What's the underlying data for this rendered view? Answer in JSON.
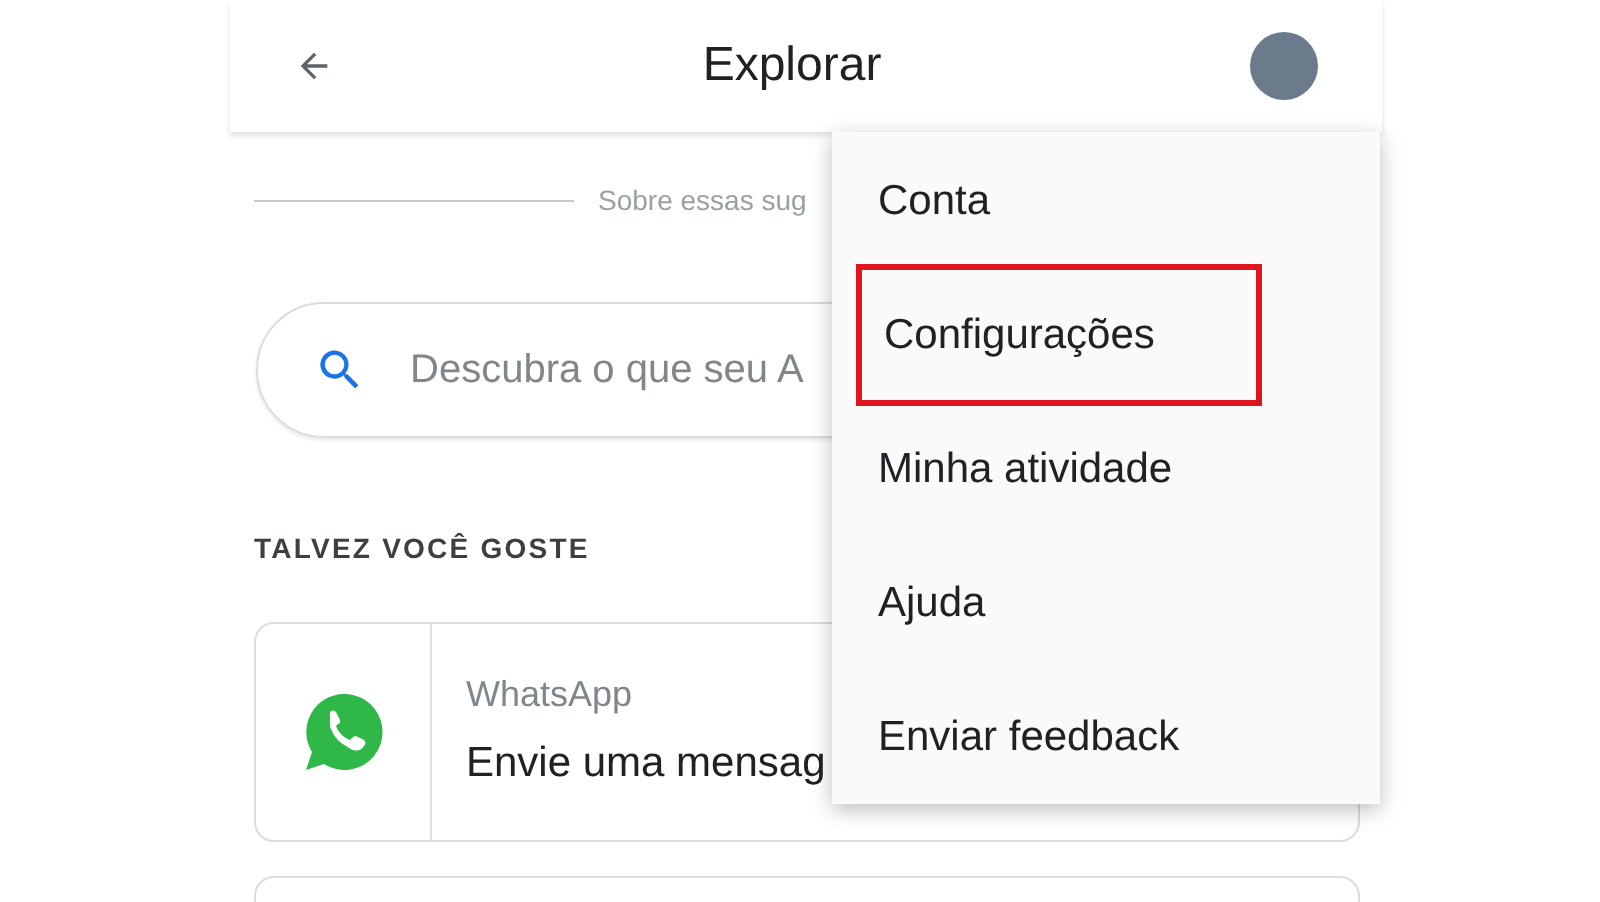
{
  "header": {
    "title": "Explorar"
  },
  "about": {
    "text": "Sobre essas sug"
  },
  "search": {
    "placeholder": "Descubra o que seu A"
  },
  "section": {
    "title": "TALVEZ VOCÊ GOSTE"
  },
  "cards": [
    {
      "app": "WhatsApp",
      "text": "Envie uma mensag"
    }
  ],
  "menu": {
    "items": [
      {
        "label": "Conta",
        "highlighted": false
      },
      {
        "label": "Configurações",
        "highlighted": true
      },
      {
        "label": "Minha atividade",
        "highlighted": false
      },
      {
        "label": "Ajuda",
        "highlighted": false
      },
      {
        "label": "Enviar feedback",
        "highlighted": false
      }
    ]
  }
}
